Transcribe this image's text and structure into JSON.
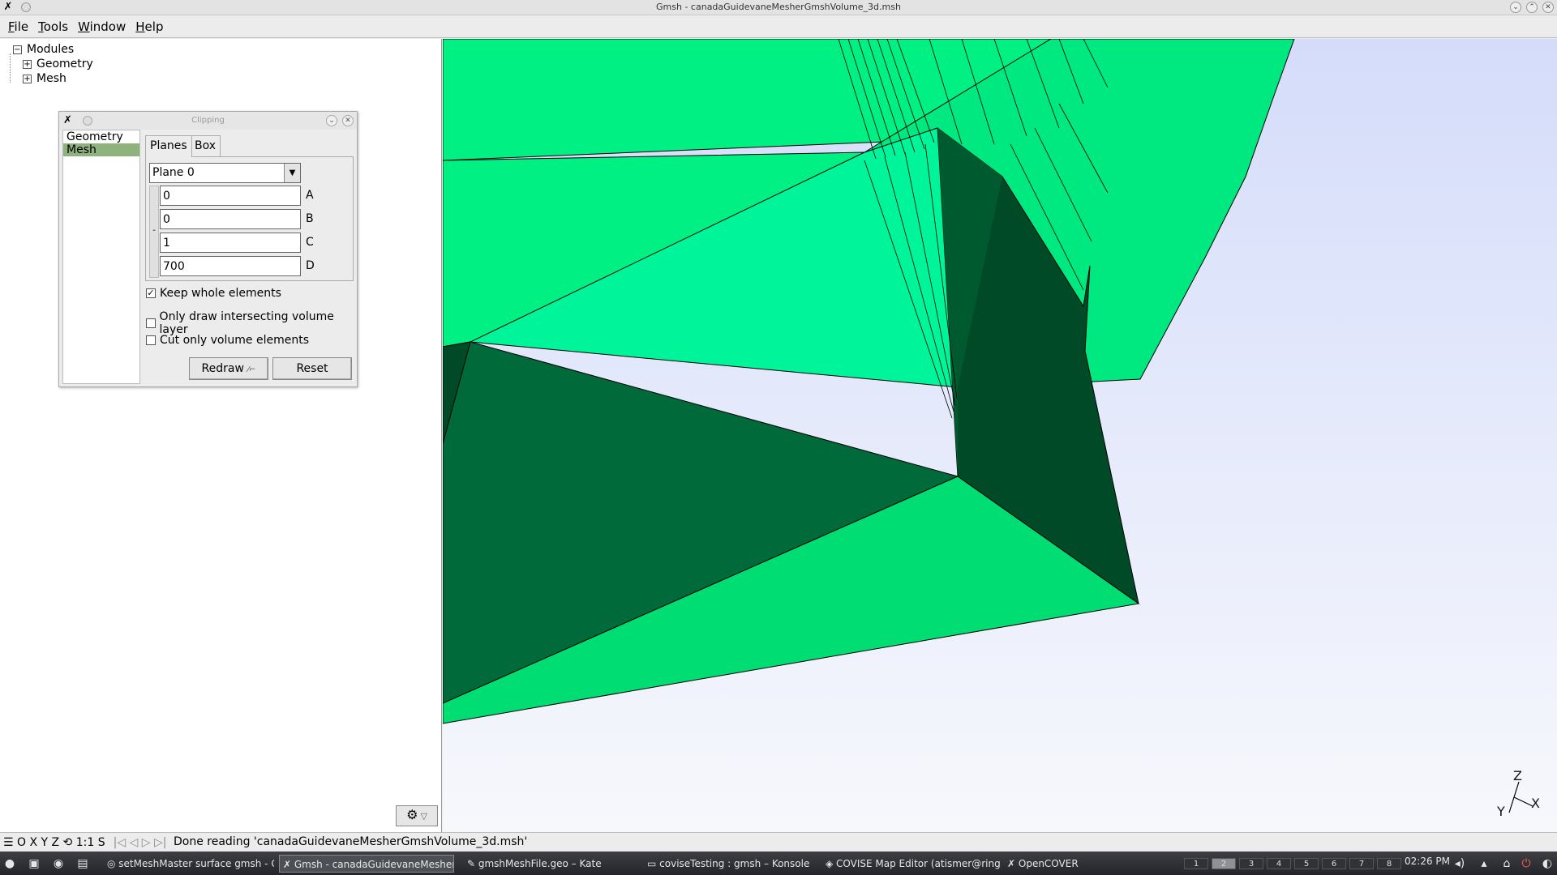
{
  "window": {
    "title": "Gmsh - canadaGuidevaneMesherGmshVolume_3d.msh"
  },
  "menu": [
    {
      "label": "File",
      "accel": "F",
      "rest": "ile"
    },
    {
      "label": "Tools",
      "accel": "T",
      "rest": "ools"
    },
    {
      "label": "Window",
      "accel": "W",
      "rest": "indow"
    },
    {
      "label": "Help",
      "accel": "H",
      "rest": "elp"
    }
  ],
  "tree": {
    "root": "Modules",
    "children": [
      "Geometry",
      "Mesh"
    ]
  },
  "clipping": {
    "title": "Clipping",
    "list": [
      "Geometry",
      "Mesh"
    ],
    "selected": "Mesh",
    "tabs": [
      "Planes",
      "Box"
    ],
    "plane_select": "Plane 0",
    "coefficients": [
      {
        "label": "A",
        "value": "0"
      },
      {
        "label": "B",
        "value": "0"
      },
      {
        "label": "C",
        "value": "1"
      },
      {
        "label": "D",
        "value": "700"
      }
    ],
    "side_minus": "-",
    "checks": [
      {
        "label": "Keep whole elements",
        "checked": true
      },
      {
        "label": "Only draw intersecting volume layer",
        "checked": false
      },
      {
        "label": "Cut only volume elements",
        "checked": false
      }
    ],
    "redraw_label": "Redraw",
    "reset_label": "Reset"
  },
  "axes": {
    "x": "X",
    "y": "Y",
    "z": "Z"
  },
  "status": {
    "buttons": "☰ O X Y Z ⟲ 1:1 S",
    "message": "Done reading 'canadaGuidevaneMesherGmshVolume_3d.msh'"
  },
  "taskbar": {
    "tasks": [
      {
        "label": "setMeshMaster surface gmsh - Go",
        "active": false
      },
      {
        "label": "Gmsh - canadaGuidevaneMesher",
        "active": true
      },
      {
        "label": "gmshMeshFile.geo – Kate",
        "active": false
      },
      {
        "label": "coviseTesting : gmsh – Konsole",
        "active": false
      },
      {
        "label": "COVISE Map Editor (atismer@ring",
        "active": false
      },
      {
        "label": "OpenCOVER",
        "active": false
      }
    ],
    "desktops": [
      "1",
      "2",
      "3",
      "4",
      "5",
      "6",
      "7",
      "8"
    ],
    "clock": "02:26 PM"
  },
  "colors": {
    "mesh_light": "#00f59a",
    "mesh_mid": "#00dd72",
    "mesh_dark": "#006a3a",
    "mesh_darker": "#004a28",
    "sky_top": "#d4dcfa",
    "sky_bottom": "#f7f8fc",
    "selection": "#8fb37d"
  }
}
